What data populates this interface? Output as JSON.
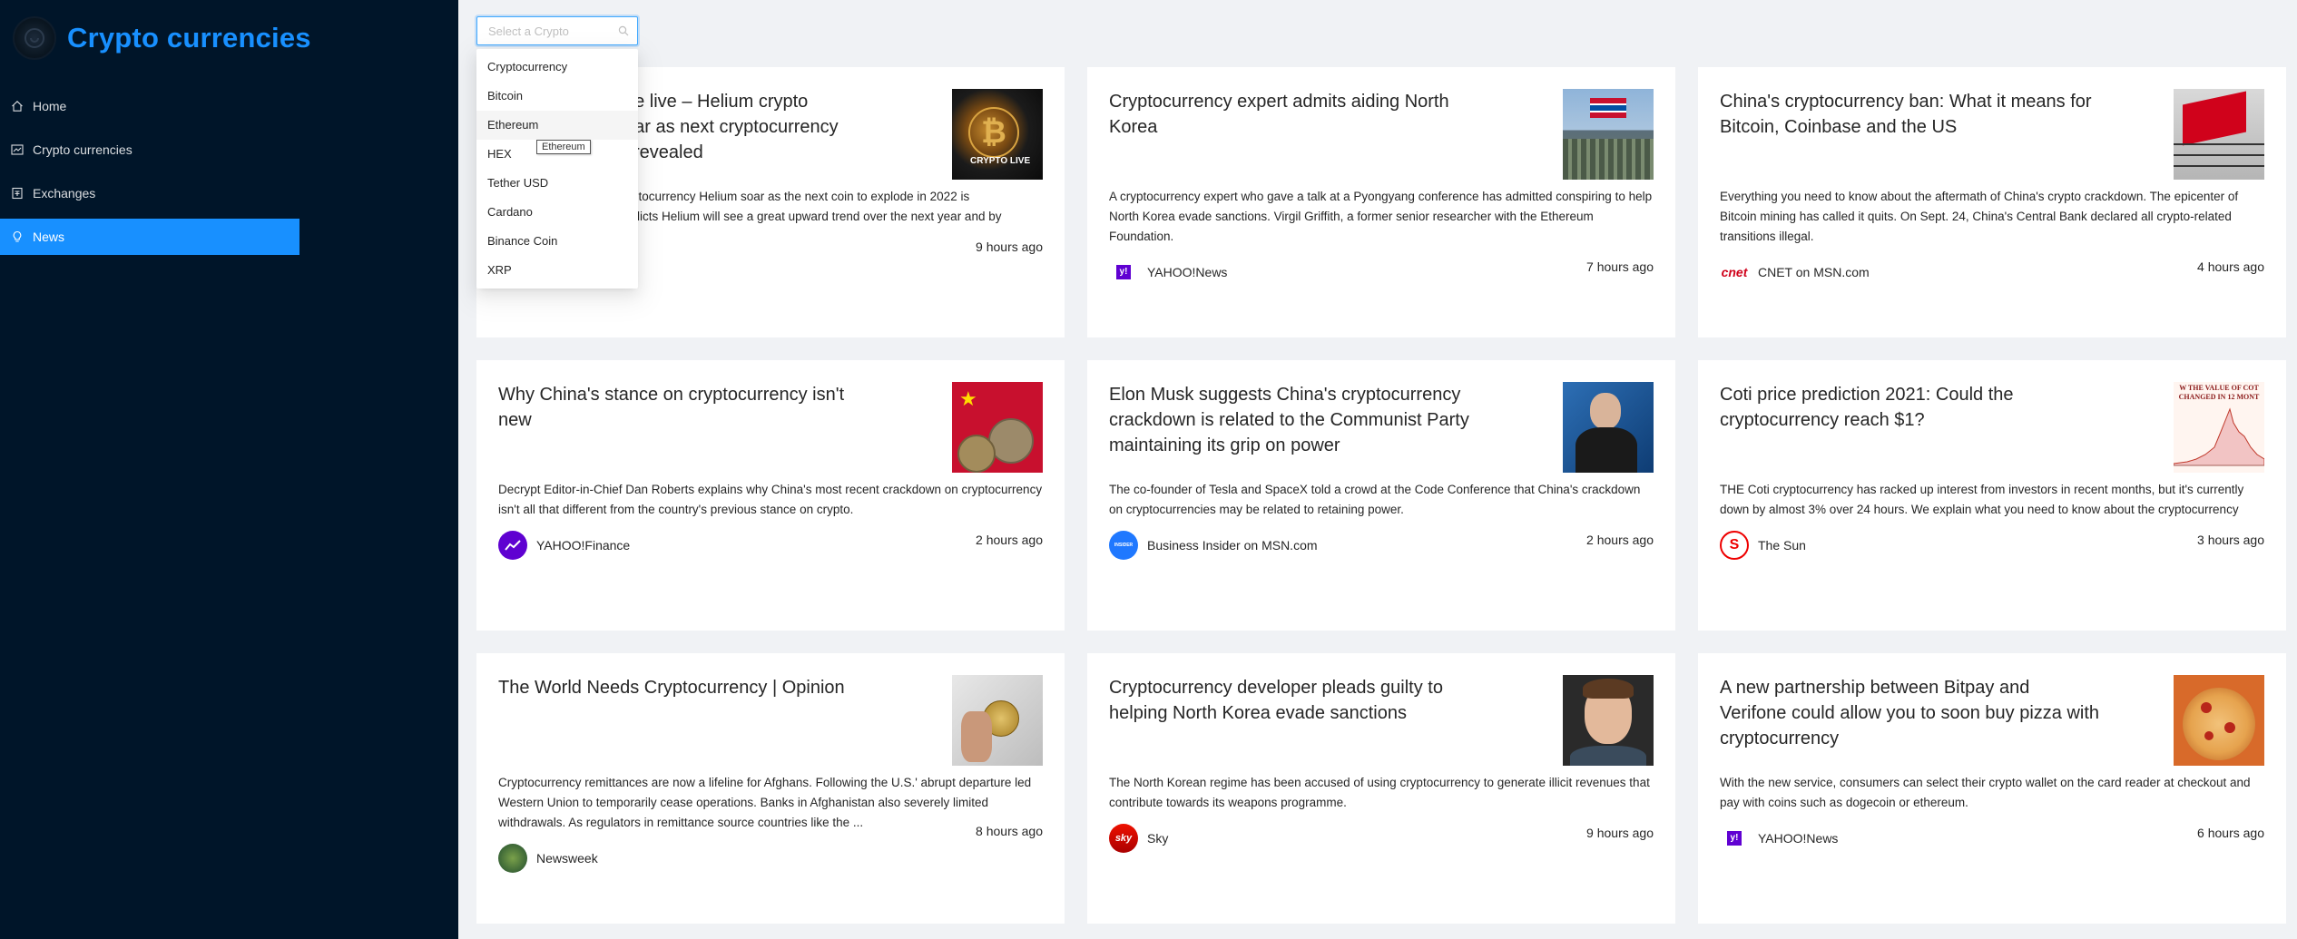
{
  "app": {
    "title": "Crypto currencies"
  },
  "menu": [
    {
      "label": "Home",
      "icon": "home-icon"
    },
    {
      "label": "Crypto currencies",
      "icon": "fund-icon"
    },
    {
      "label": "Exchanges",
      "icon": "money-collect-icon"
    },
    {
      "label": "News",
      "icon": "bulb-icon",
      "active": true
    }
  ],
  "search": {
    "placeholder": "Select a Crypto",
    "value": ""
  },
  "dropdown": {
    "options": [
      "Cryptocurrency",
      "Bitcoin",
      "Ethereum",
      "HEX",
      "Tether USD",
      "Cardano",
      "Binance Coin",
      "XRP"
    ],
    "hovered": "Ethereum",
    "tooltip": "Ethereum"
  },
  "news": [
    {
      "title": "Helium price live – Helium crypto soar as next cryptocurrency is revealed",
      "visible_title_lines": [
        "rice live – Helium crypto",
        "soar as next cryptocurrency",
        "is revealed"
      ],
      "description": "cryptocurrency Helium soar as the next coin to explode in 2022 is predicts Helium will see a great upward trend over the next year and by",
      "visible_desc_lines": [
        "cryptocurrency Helium soar as the next coin to explode in 2022 is",
        "predicts Helium will see a great upward trend over the next year and by"
      ],
      "image_text": "CRYPTO LIVE",
      "provider": "",
      "time": "9 hours ago"
    },
    {
      "title": "Cryptocurrency expert admits aiding North Korea",
      "description": "A cryptocurrency expert who gave a talk at a Pyongyang conference has admitted conspiring to help North Korea evade sanctions. Virgil Griffith, a former senior researcher with the Ethereum Foundation.",
      "provider": "YAHOO!News",
      "time": "7 hours ago"
    },
    {
      "title": "China's cryptocurrency ban: What it means for Bitcoin, Coinbase and the US",
      "description": "Everything you need to know about the aftermath of China's crypto crackdown. The epicenter of Bitcoin mining has called it quits. On Sept. 24, China's Central Bank declared all crypto-related transitions illegal.",
      "provider": "CNET on MSN.com",
      "provider_logo_text": "cnet",
      "time": "4 hours ago"
    },
    {
      "title": "Why China's stance on cryptocurrency isn't new",
      "description": "Decrypt Editor-in-Chief Dan Roberts explains why China's most recent crackdown on cryptocurrency isn't all that different from the country's previous stance on crypto.",
      "provider": "YAHOO!Finance",
      "time": "2 hours ago"
    },
    {
      "title": "Elon Musk suggests China's cryptocurrency crackdown is related to the Communist Party maintaining its grip on power",
      "description": "The co-founder of Tesla and SpaceX told a crowd at the Code Conference that China's crackdown on cryptocurrencies may be related to retaining power.",
      "provider": "Business Insider on MSN.com",
      "time": "2 hours ago"
    },
    {
      "title": "Coti price prediction 2021: Could the cryptocurrency reach $1?",
      "description": "THE Coti cryptocurrency has racked up interest from investors in recent months, but it's currently down by almost 3% over 24 hours. We explain what you need to know about the cryptocurrency",
      "image_text": "W THE VALUE OF COT CHANGED IN 12 MONT",
      "provider": "The Sun",
      "time": "3 hours ago"
    },
    {
      "title": "The World Needs Cryptocurrency | Opinion",
      "description": "Cryptocurrency remittances are now a lifeline for Afghans. Following the U.S.' abrupt departure led Western Union to temporarily cease operations. Banks in Afghanistan also severely limited withdrawals. As regulators in remittance source countries like the ...",
      "provider": "Newsweek",
      "time": "8 hours ago"
    },
    {
      "title": "Cryptocurrency developer pleads guilty to helping North Korea evade sanctions",
      "description": "The North Korean regime has been accused of using cryptocurrency to generate illicit revenues that contribute towards its weapons programme.",
      "provider": "Sky",
      "provider_logo_text": "sky",
      "time": "9 hours ago"
    },
    {
      "title": "A new partnership between Bitpay and Verifone could allow you to soon buy pizza with cryptocurrency",
      "description": "With the new service, consumers can select their crypto wallet on the card reader at checkout and pay with coins such as dogecoin or ethereum.",
      "provider": "YAHOO!News",
      "time": "6 hours ago"
    }
  ],
  "colors": {
    "sidebar": "#001529",
    "accent": "#1890ff",
    "bg": "#f0f2f5"
  }
}
